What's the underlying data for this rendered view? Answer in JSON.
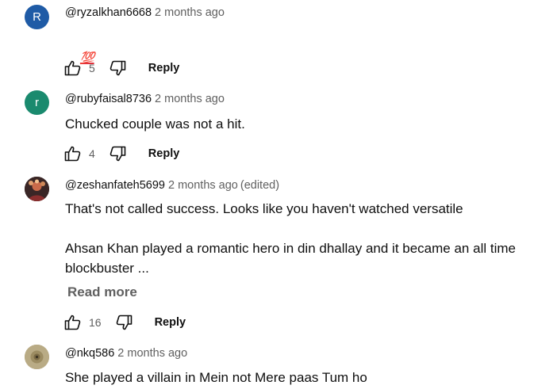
{
  "comments": [
    {
      "avatar_letter": "R",
      "avatar_color": "#1f5ba6",
      "author": "@ryzalkhan6668",
      "time": "2 months ago",
      "text": "💯",
      "likes": "5",
      "reply_label": "Reply"
    },
    {
      "avatar_letter": "r",
      "avatar_color": "#1a8a6e",
      "author": "@rubyfaisal8736",
      "time": "2 months ago",
      "text": "Chucked couple was not a hit.",
      "likes": "4",
      "reply_label": "Reply"
    },
    {
      "avatar_letter": "",
      "avatar_color": "#6b2b2b",
      "author": "@zeshanfateh5699",
      "time": "2 months ago",
      "edited": "(edited)",
      "text": "That's not called success. Looks like you haven't watched versatile\n\nAhsan Khan played a romantic hero in din dhallay and it became an all time\nblockbuster ...",
      "read_more": "Read more",
      "likes": "16",
      "reply_label": "Reply"
    },
    {
      "avatar_letter": "",
      "avatar_color": "#b9ab85",
      "author": "@nkq586",
      "time": "2 months ago",
      "text": "She played a villain in Mein not Mere paas Tum ho"
    }
  ]
}
